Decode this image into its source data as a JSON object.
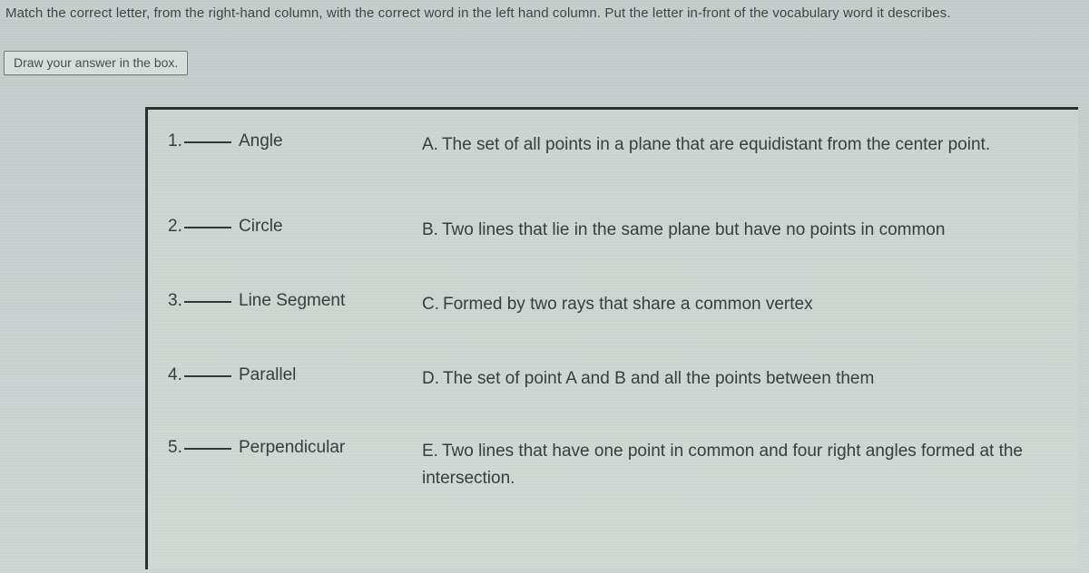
{
  "instruction": "Match the correct letter, from the right-hand column, with the correct word in the left hand column. Put the letter in-front of the vocabulary word it describes.",
  "draw_button": "Draw your answer in the box.",
  "rows": [
    {
      "num": "1.",
      "term": "Angle",
      "letter": "A.",
      "definition": "The set of all points in a plane that are equidistant from the center point."
    },
    {
      "num": "2.",
      "term": "Circle",
      "letter": "B.",
      "definition": "Two lines that lie in the same plane but have no points in common"
    },
    {
      "num": "3.",
      "term": "Line Segment",
      "letter": "C.",
      "definition": "Formed by two rays that share a common vertex"
    },
    {
      "num": "4.",
      "term": "Parallel",
      "letter": "D.",
      "definition": "The set of point A and B and all the points between them"
    },
    {
      "num": "5.",
      "term": "Perpendicular",
      "letter": "E.",
      "definition": "Two lines that have one point in common and four right angles formed at the intersection."
    }
  ]
}
